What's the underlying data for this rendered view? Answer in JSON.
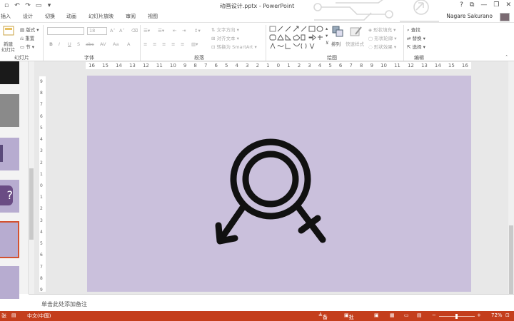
{
  "window": {
    "title": "动画设计.pptx - PowerPoint",
    "controls": [
      "?",
      "⧉",
      "—",
      "❐",
      "✕"
    ]
  },
  "qat": {
    "icons": [
      "save-icon",
      "undo-icon",
      "redo-icon",
      "start-from-beginning-icon"
    ]
  },
  "tabs": [
    "插入",
    "设计",
    "切换",
    "动画",
    "幻灯片放映",
    "审阅",
    "视图"
  ],
  "user": {
    "name": "Nagare Sakurano"
  },
  "ribbon": {
    "slides_group": {
      "new_slide_line1": "新建",
      "new_slide_line2": "幻灯片",
      "layout": "版式",
      "reset": "重置",
      "section": "节",
      "label": "幻灯片"
    },
    "font_group": {
      "font_size": "18",
      "bold": "B",
      "italic": "I",
      "underline": "U",
      "shadow": "S",
      "strike": "abc",
      "spacing": "AV",
      "case": "Aa",
      "color": "A",
      "grow": "A˄",
      "shrink": "A˅",
      "label": "字体"
    },
    "paragraph_group": {
      "text_direction": "文字方向",
      "align_text": "对齐文本",
      "smartart": "转换为 SmartArt",
      "label": "段落"
    },
    "drawing_group": {
      "arrange": "排列",
      "quick_styles": "快速样式",
      "shape_fill": "形状填充",
      "shape_outline": "形状轮廓",
      "shape_effects": "形状效果",
      "label": "绘图"
    },
    "editing_group": {
      "find": "查找",
      "replace": "替换",
      "select": "选择",
      "label": "编辑"
    }
  },
  "ruler": {
    "horizontal": [
      "16",
      "15",
      "14",
      "13",
      "12",
      "11",
      "10",
      "9",
      "8",
      "7",
      "6",
      "5",
      "4",
      "3",
      "2",
      "1",
      "0",
      "1",
      "2",
      "3",
      "4",
      "5",
      "6",
      "7",
      "8",
      "9",
      "10",
      "11",
      "12",
      "13",
      "14",
      "15",
      "16"
    ],
    "vertical": [
      "9",
      "8",
      "7",
      "6",
      "5",
      "4",
      "3",
      "2",
      "1",
      "0",
      "1",
      "2",
      "3",
      "4",
      "5",
      "6",
      "7",
      "8",
      "9"
    ]
  },
  "slide": {
    "background": "#cac0dc",
    "symbol": "gender-symbol-icon"
  },
  "notes": {
    "placeholder": "单击此处添加备注"
  },
  "status": {
    "slide_label": "张",
    "language": "中文(中国)",
    "notes": "备注",
    "comments": "批注",
    "zoom": "72%",
    "accent": "#c43e1c"
  }
}
